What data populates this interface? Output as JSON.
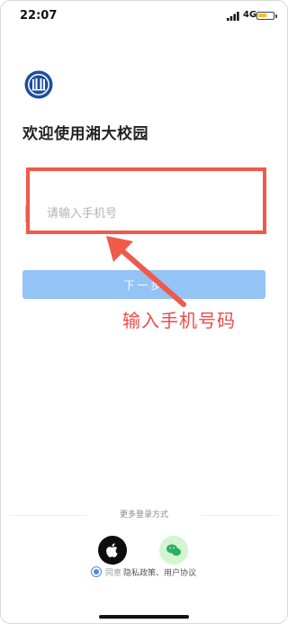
{
  "status_bar": {
    "time": "22:07",
    "network": "4G",
    "battery_level": 0.6,
    "battery_color": "#f4c21b"
  },
  "logo": {
    "icon": "university-seal-icon"
  },
  "welcome": {
    "title": "欢迎使用湘大校园"
  },
  "phone_field": {
    "placeholder": "请输入手机号",
    "value": ""
  },
  "next_button": {
    "label": "下一步",
    "color": "#94c3f6"
  },
  "annotation": {
    "text": "输入手机号码",
    "color": "#ec4c4c"
  },
  "alt_login": {
    "label": "更多登录方式",
    "options": [
      {
        "icon": "apple-icon",
        "color": "#0d0d0d"
      },
      {
        "icon": "wechat-icon",
        "color": "#d4f5d2"
      }
    ]
  },
  "agreement": {
    "agree_label": "同意",
    "policy_label": "隐私政策、用户协议",
    "checked": true
  }
}
